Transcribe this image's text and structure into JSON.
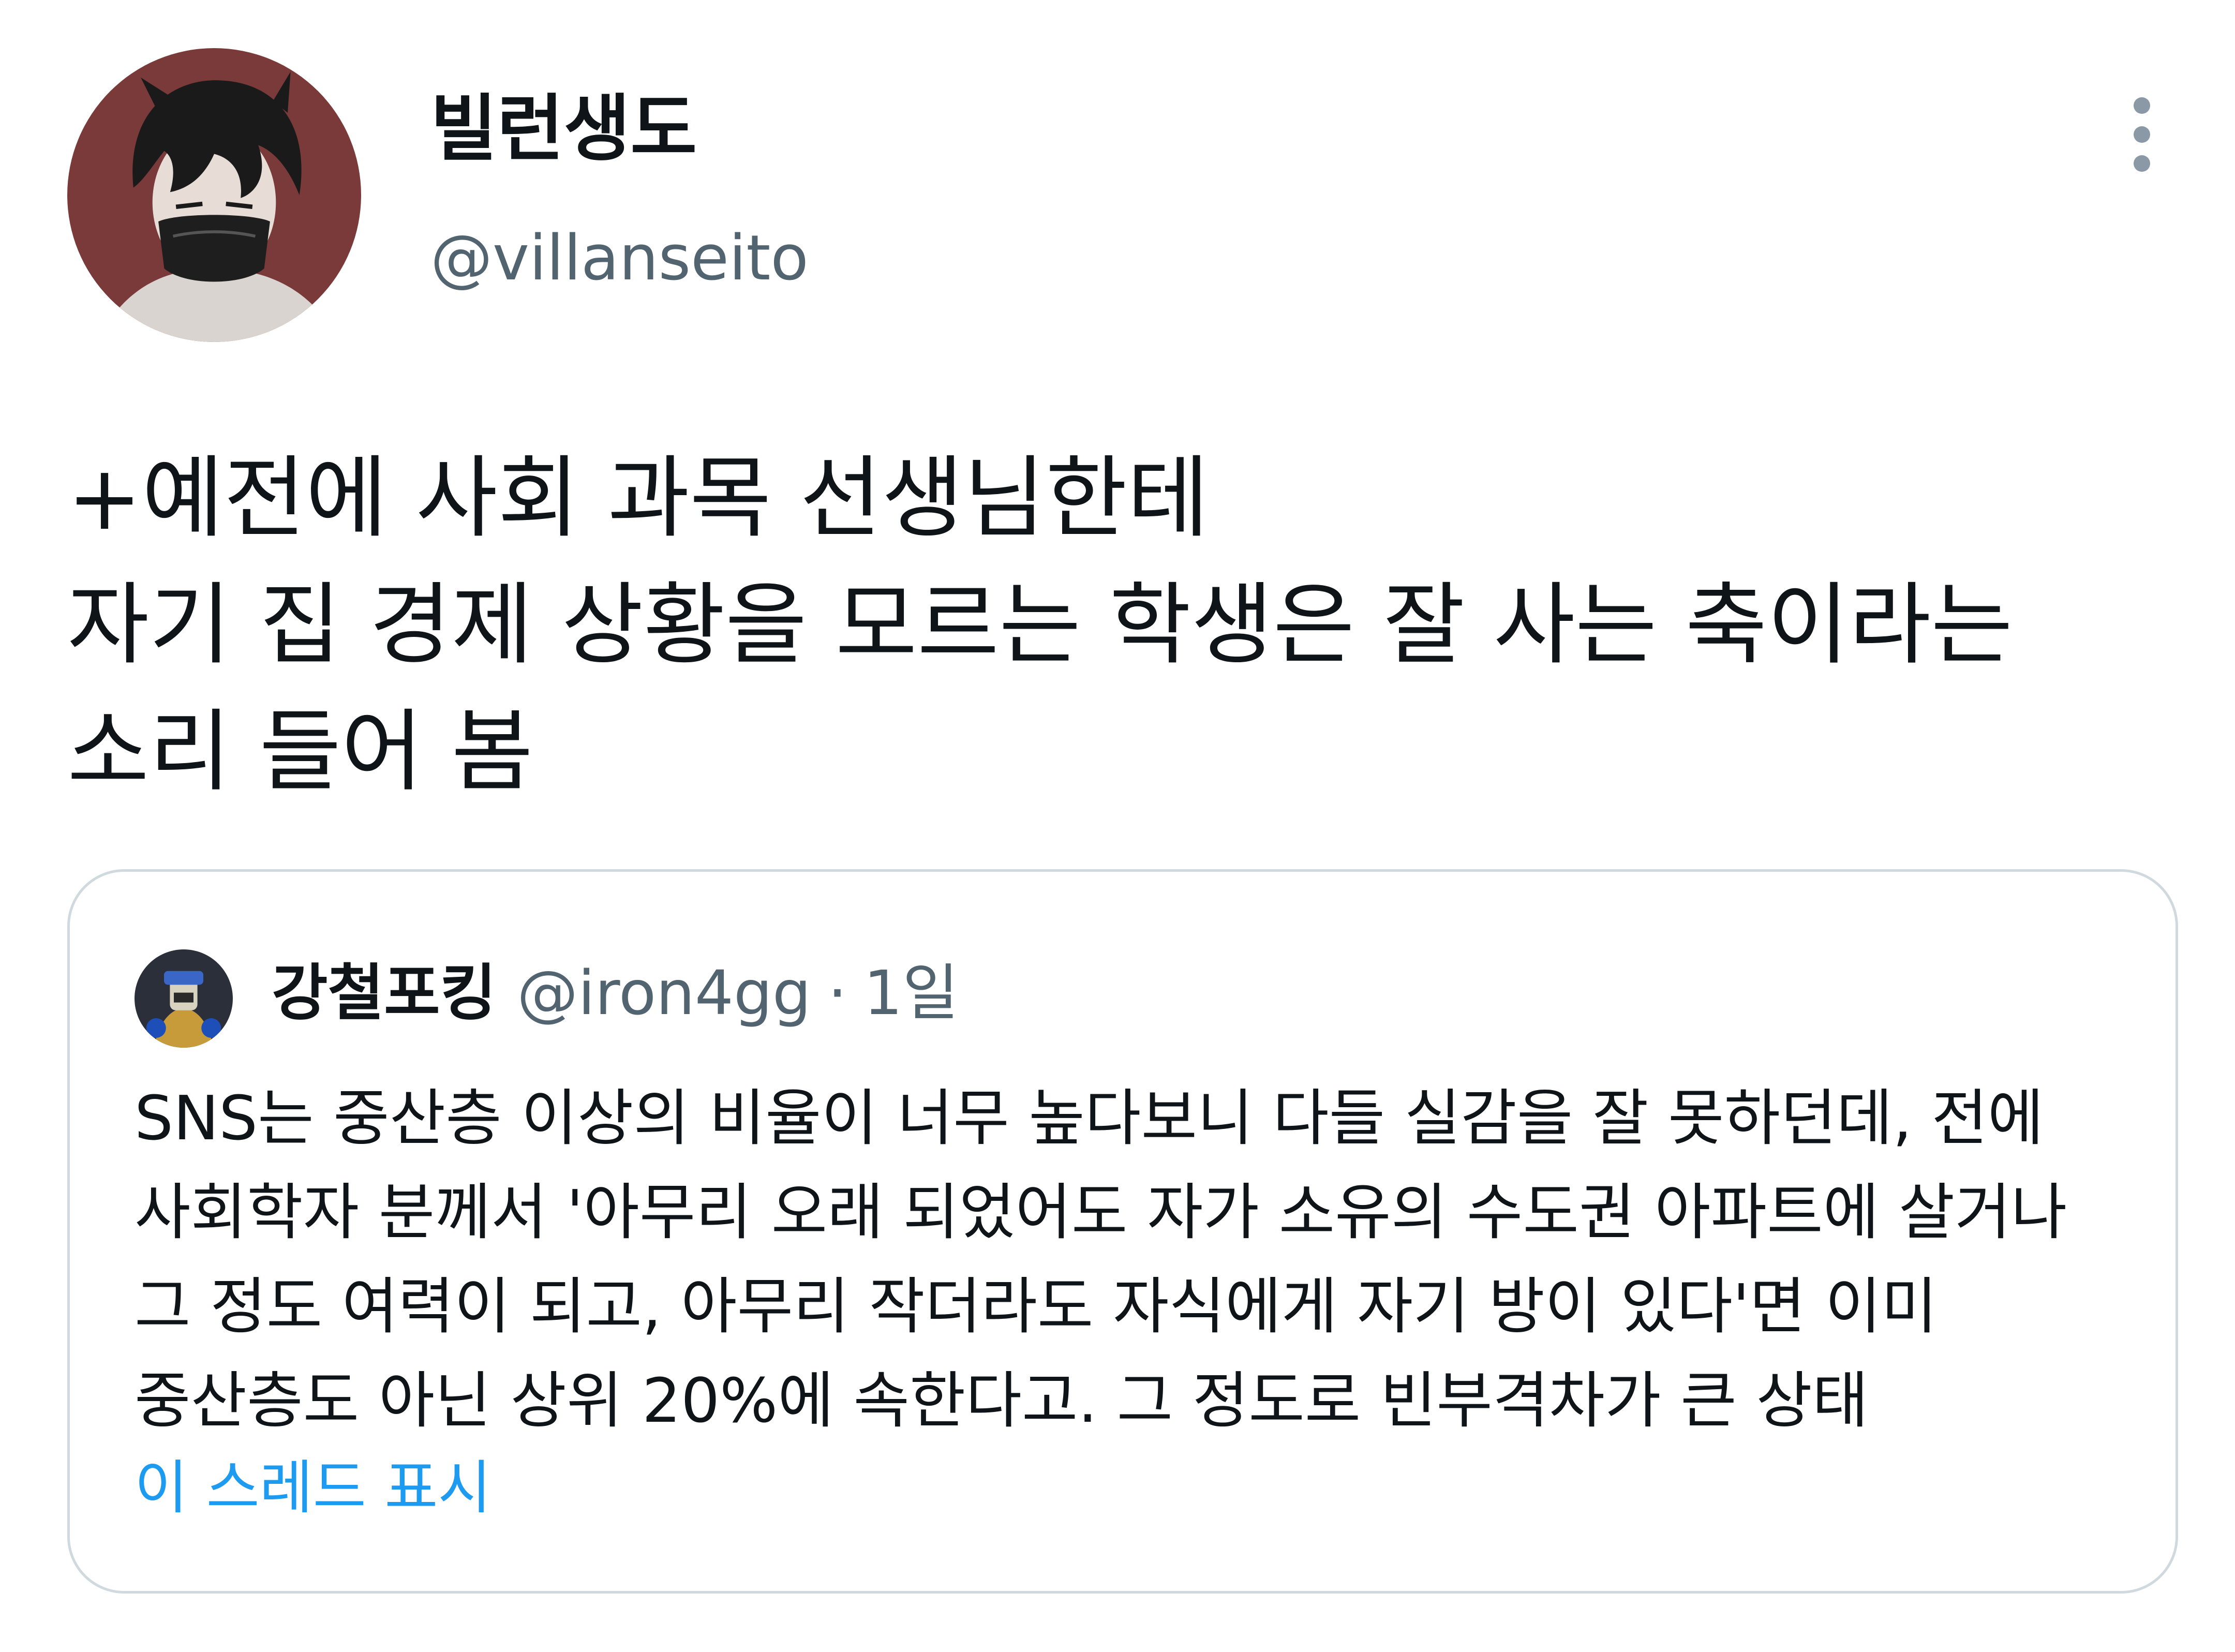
{
  "author": {
    "display_name": "빌런생도",
    "handle": "@villanseito",
    "avatar_icon": "user-avatar-illustration"
  },
  "menu": {
    "icon": "more-vertical-icon"
  },
  "tweet": {
    "lines": [
      "+예전에 사회 과목 선생님한테",
      "자기 집 경제 상황을 모르는 학생은 잘 사는 축이라는",
      "소리 들어 봄"
    ]
  },
  "quote": {
    "display_name": "강철포킹",
    "handle": "@iron4gg",
    "separator": "·",
    "time": "1일",
    "avatar_icon": "quoted-user-avatar",
    "lines": [
      "SNS는 중산층 이상의 비율이 너무 높다보니 다들 실감을 잘 못하던데, 전에",
      "사회학자 분께서 '아무리 오래 되었어도 자가 소유의 수도권 아파트에 살거나",
      "그 정도 여력이 되고, 아무리 작더라도 자식에게 자기 방이 있다'면 이미",
      "중산층도 아닌 상위 20%에 속한다고. 그 정도로 빈부격차가 큰 상태"
    ],
    "show_thread": "이 스레드 표시"
  },
  "colors": {
    "text_primary": "#0f1419",
    "text_secondary": "#536471",
    "link": "#1d9bf0",
    "border": "#cfd9de"
  }
}
